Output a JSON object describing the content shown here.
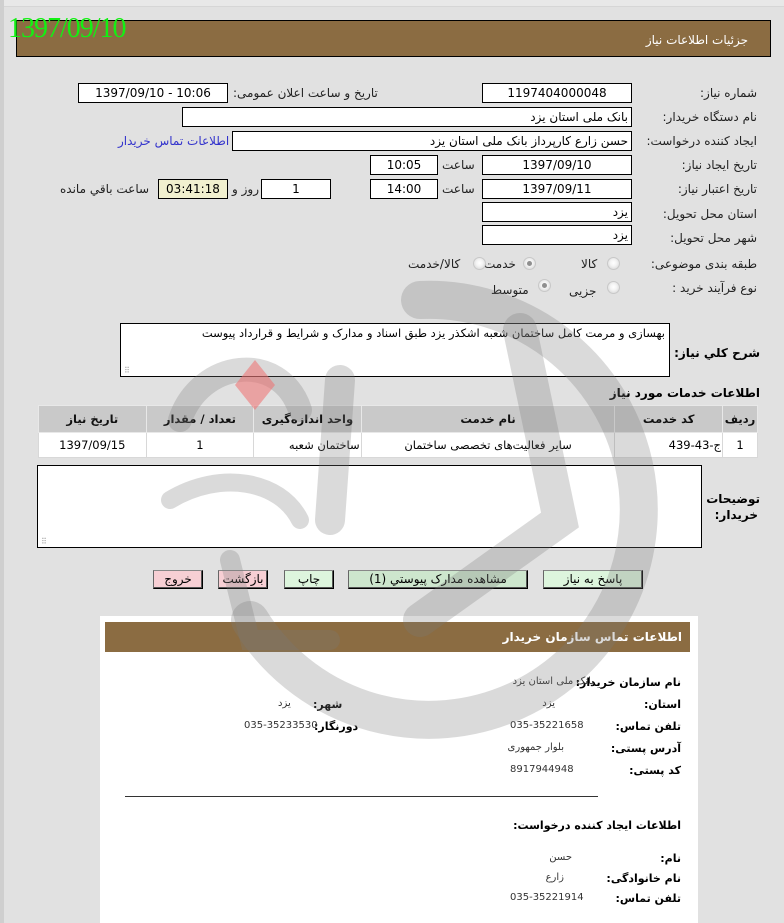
{
  "stamp_date": "1397/09/10",
  "header": {
    "title": "جزئیات اطلاعات نیاز"
  },
  "form": {
    "need_number": {
      "label": "شماره نیاز:",
      "value": "1197404000048"
    },
    "announce": {
      "label": "تاریخ و ساعت اعلان عمومی:",
      "value": "1397/09/10 - 10:06"
    },
    "buyer_org": {
      "label": "نام دستگاه خریدار:",
      "value": "بانک ملی استان یزد"
    },
    "requester": {
      "label": "ایجاد کننده درخواست:",
      "value": "حسن زارع کارپرداز بانک ملی استان یزد",
      "contact_link": "اطلاعات تماس خریدار"
    },
    "created": {
      "label": "تاریخ ایجاد نیاز:",
      "date": "1397/09/10",
      "time_label": "ساعت",
      "time": "10:05"
    },
    "validity": {
      "label": "تاریخ اعتبار نیاز:",
      "date": "1397/09/11",
      "time_label": "ساعت",
      "time": "14:00",
      "days": "1",
      "days_label": "روز و",
      "remaining": "03:41:18",
      "remaining_label": "ساعت باقي مانده"
    },
    "province": {
      "label": "استان محل تحویل:",
      "value": "یزد"
    },
    "city": {
      "label": "شهر محل تحویل:",
      "value": "یزد"
    },
    "category": {
      "label": "طبقه بندی موضوعی:",
      "options": [
        "کالا",
        "خدمت",
        "کالا/خدمت"
      ],
      "selected": "خدمت"
    },
    "purchase_type": {
      "label": "نوع فرآیند خرید :",
      "options": [
        "جزیی",
        "متوسط"
      ],
      "selected": "متوسط"
    },
    "description": {
      "label": "شرح کلي نياز:",
      "value": "بهسازی و مرمت کامل ساختمان شعبه اشکذر یزد طبق اسناد و مدارک و شرایط و قرارداد پیوست"
    },
    "services_title": "اطلاعات خدمات مورد نیاز",
    "buyer_notes": {
      "label_line1": "توضیحات",
      "label_line2": "خریدار:",
      "value": ""
    }
  },
  "table": {
    "headers": [
      "ردیف",
      "کد خدمت",
      "نام خدمت",
      "واحد اندازه‌گیری",
      "تعداد / مقدار",
      "تاریخ نیاز"
    ],
    "rows": [
      [
        "1",
        "ج-43-439",
        "سایر فعالیت‌های تخصصی ساختمان",
        "ساختمان شعبه",
        "1",
        "1397/09/15"
      ]
    ]
  },
  "buttons": {
    "reply": "پاسخ به نیاز",
    "attachments": "مشاهده مدارک پیوستي (1)",
    "print": "چاپ",
    "back": "بازگشت",
    "exit": "خروج"
  },
  "contact": {
    "title": "اطلاعات تماس سازمان خریدار",
    "org_label": "نام سازمان خریدار:",
    "org_value": "بانک ملی استان یزد",
    "province_label": "استان:",
    "province_value": "یزد",
    "city_label": "شهر:",
    "city_value": "یزد",
    "phone_label": "تلفن تماس:",
    "phone_value": "035-35221658",
    "fax_label": "دورنگار:",
    "fax_value": "035-35233530",
    "address_label": "آدرس پستی:",
    "address_value": "بلوار جمهوری",
    "postal_label": "کد پستی:",
    "postal_value": "8917944948",
    "creator_title": "اطلاعات ایجاد کننده درخواست:",
    "first_name_label": "نام:",
    "first_name_value": "حسن",
    "last_name_label": "نام خانوادگی:",
    "last_name_value": "زارع",
    "creator_phone_label": "تلفن تماس:",
    "creator_phone_value": "035-35221914"
  }
}
